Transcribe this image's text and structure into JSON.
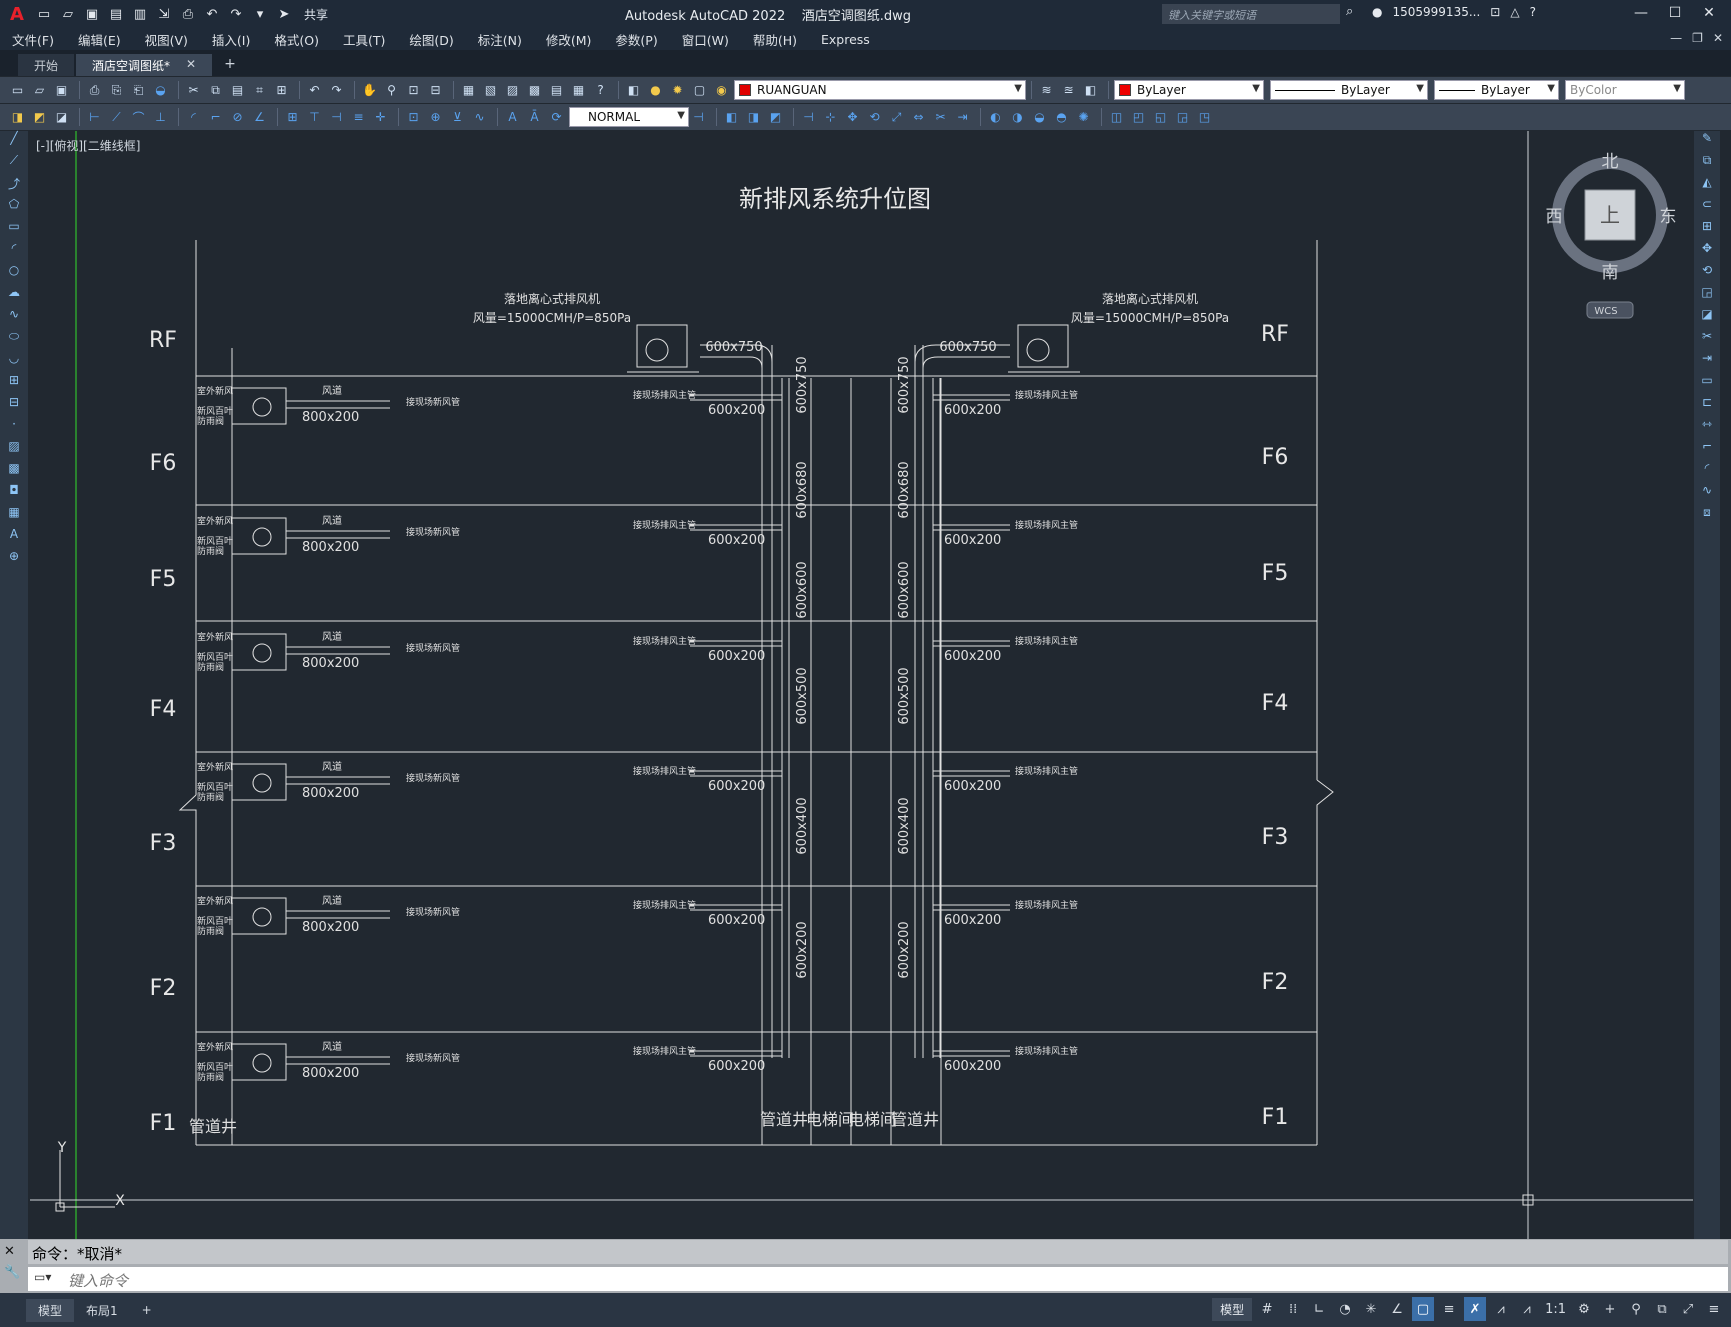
{
  "app": {
    "title": "Autodesk AutoCAD 2022",
    "file_name": "酒店空调图纸.dwg",
    "share_label": "共享",
    "search_placeholder": "键入关键字或短语",
    "user": "1505999135...",
    "logo": "A"
  },
  "menu": [
    "文件(F)",
    "编辑(E)",
    "视图(V)",
    "插入(I)",
    "格式(O)",
    "工具(T)",
    "绘图(D)",
    "标注(N)",
    "修改(M)",
    "参数(P)",
    "窗口(W)",
    "帮助(H)",
    "Express"
  ],
  "doc_tabs": [
    {
      "label": "开始",
      "active": false
    },
    {
      "label": "酒店空调图纸*",
      "active": true
    }
  ],
  "toolbar": {
    "layer": "RUANGUAN",
    "layer_color": "#e00000",
    "color": "ByLayer",
    "linetype": "ByLayer",
    "lineweight": "ByLayer",
    "plotstyle": "ByColor",
    "dimstyle": "NORMAL"
  },
  "viewport": {
    "label": "[-][俯视][二维线框]"
  },
  "viewcube": {
    "north": "北",
    "south": "南",
    "east": "东",
    "west": "西",
    "face": "上",
    "wcs": "WCS"
  },
  "drawing": {
    "title": "新排风系统升位图",
    "floors": [
      "RF",
      "F6",
      "F5",
      "F4",
      "F3",
      "F2",
      "F1"
    ],
    "fan_label": "落地离心式排风机",
    "fan_spec": "风量=15000CMH/P=850Pa",
    "fan_duct": "600x750",
    "branch_duct": "600x200",
    "fresh_duct": "800x200",
    "riser_sizes": [
      "600x750",
      "600x680",
      "600x600",
      "600x500",
      "600x400",
      "600x200"
    ],
    "unit_labels": {
      "outdoor_air": "室外新风",
      "fresh_louver": "新风百叶",
      "damper": "防雨阀",
      "duct": "风道",
      "fresh_main": "接现场新风管",
      "exhaust_main": "接现场排风主管"
    },
    "bottom_labels": [
      "管道井",
      "管道井",
      "电梯间",
      "电梯间",
      "管道井"
    ],
    "ucs_y": "Y",
    "ucs_x": "X"
  },
  "command": {
    "history": "命令：*取消*",
    "placeholder": "键入命令"
  },
  "layout_tabs": [
    "模型",
    "布局1"
  ],
  "status": {
    "model": "模型",
    "scale": "1:1"
  }
}
